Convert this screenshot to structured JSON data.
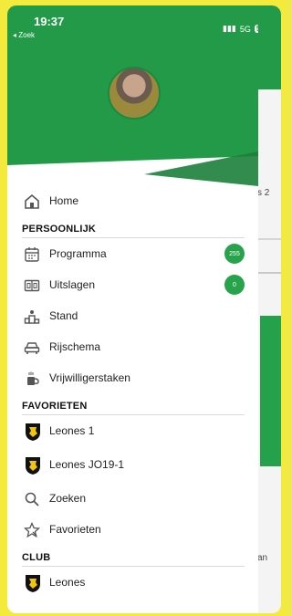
{
  "status_bar": {
    "time": "19:37",
    "back_label": "◂ Zoek",
    "network": "5G",
    "battery": "50"
  },
  "background_app": {
    "snippet_1": "s 2",
    "snippet_2": "an"
  },
  "menu": {
    "home_label": "Home",
    "section_personal": "PERSOONLIJK",
    "programma_label": "Programma",
    "programma_count": "255",
    "uitslagen_label": "Uitslagen",
    "uitslagen_count": "0",
    "stand_label": "Stand",
    "rijschema_label": "Rijschema",
    "vrijwilligers_label": "Vrijwilligerstaken",
    "section_favorites": "FAVORIETEN",
    "fav_team_1": "Leones 1",
    "fav_team_2": "Leones JO19-1",
    "zoeken_label": "Zoeken",
    "favorieten_label": "Favorieten",
    "section_club": "CLUB",
    "club_label": "Leones"
  },
  "colors": {
    "brand_green": "#239a48",
    "badge_green": "#27a34c",
    "frame_yellow": "#f3ea3c"
  }
}
